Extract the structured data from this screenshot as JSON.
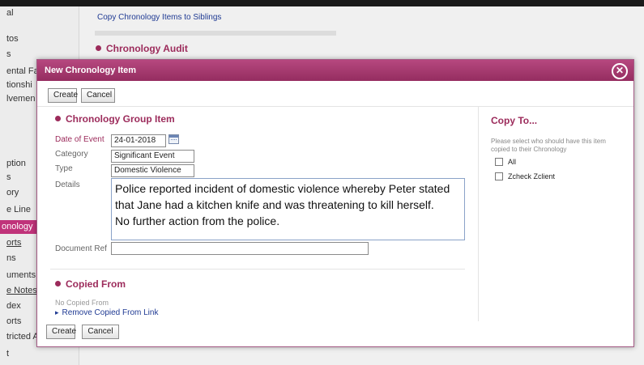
{
  "sidebar": {
    "items": [
      "al",
      "tos",
      "s",
      "ental Fa",
      "tionshi",
      "lvemen",
      "ption",
      "s",
      "ory",
      "e Line",
      "onology",
      "orts",
      "ns",
      "uments",
      "e Notes",
      "dex",
      "orts",
      "tricted A",
      "t"
    ]
  },
  "background": {
    "link": "Copy Chronology Items to Siblings",
    "heading": "Chronology Audit"
  },
  "dialog": {
    "title": "New Chronology Item",
    "close_glyph": "✕",
    "create_label": "Create",
    "cancel_label": "Cancel",
    "group_heading": "Chronology Group Item",
    "form": {
      "date_label": "Date of Event",
      "date_value": "24-01-2018",
      "category_label": "Category",
      "category_value": "Significant Event",
      "type_label": "Type",
      "type_value": "Domestic Violence",
      "details_label": "Details",
      "details_value": "Police reported incident of domestic violence whereby Peter stated that Jane had a kitchen knife and was threatening to kill herself.\nNo further action from the police.",
      "docref_label": "Document Ref",
      "docref_value": ""
    },
    "copied_from": {
      "heading": "Copied From",
      "empty_text": "No Copied From",
      "remove_link": "Remove Copied From Link"
    },
    "copy_to": {
      "title": "Copy To...",
      "note": "Please select who should have this item copied to their Chronology",
      "options": [
        {
          "label": "All",
          "checked": false
        },
        {
          "label": "Zcheck Zclient",
          "checked": false
        }
      ]
    }
  },
  "colors": {
    "accent": "#9c2b5b",
    "title_bar": "#a93a72",
    "link": "#1f3a93"
  }
}
